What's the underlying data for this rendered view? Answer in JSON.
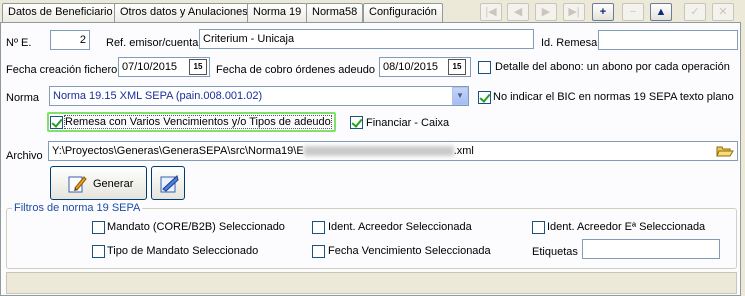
{
  "tabs": [
    {
      "label": "Datos de Beneficiario"
    },
    {
      "label": "Otros datos y Anulaciones"
    },
    {
      "label": "Norma 19"
    },
    {
      "label": "Norma58"
    },
    {
      "label": "Configuración"
    }
  ],
  "toolbar": {
    "first": "|◀",
    "prev": "◀",
    "next": "▶",
    "last": "▶|",
    "add": "+",
    "remove": "−",
    "up": "▲",
    "confirm": "✓",
    "cancel": "✕"
  },
  "form": {
    "num_label": "Nº E.",
    "num_value": "2",
    "ref_label": "Ref. emisor/cuenta",
    "ref_value": "Criterium - Unicaja",
    "id_remesa_label": "Id. Remesa",
    "id_remesa_value": "",
    "fecha_creacion_label": "Fecha creación fichero",
    "fecha_creacion_value": "07/10/2015",
    "fecha_cobro_label": "Fecha de cobro órdenes adeudo",
    "fecha_cobro_value": "08/10/2015",
    "calendar_icon": "15",
    "detalle_label": "Detalle del abono: un abono por cada operación",
    "norma_label": "Norma",
    "norma_value": "Norma 19.15 XML SEPA (pain.008.001.02)",
    "no_bic_label": "No indicar el BIC en normas 19 SEPA texto plano",
    "remesa_varios_label": "Remesa con Varios Vencimientos y/o Tipos de adeudo",
    "financiar_label": "Financiar - Caixa",
    "archivo_label": "Archivo",
    "archivo_value_prefix": "Y:\\Proyectos\\Generas\\GeneraSEPA\\src\\Norma19\\E",
    "archivo_value_suffix": ".xml",
    "generar_label": "Generar"
  },
  "filtros": {
    "title": "Filtros de norma 19 SEPA",
    "mandato_label": "Mandato (CORE/B2B) Seleccionado",
    "ident_acreedor_label": "Ident. Acreedor Seleccionada",
    "ident_acreedor_e_label": "Ident. Acreedor Eª Seleccionada",
    "tipo_mandato_label": "Tipo de Mandato Seleccionado",
    "fecha_venc_label": "Fecha Vencimiento Seleccionada",
    "etiquetas_label": "Etiquetas",
    "etiquetas_value": ""
  },
  "checks": {
    "detalle": false,
    "no_bic": true,
    "remesa_varios": true,
    "financiar": true,
    "mandato": false,
    "ident_acreedor": false,
    "ident_acreedor_e": false,
    "tipo_mandato": false,
    "fecha_venc": false
  },
  "colors": {
    "accent": "#e68b2c",
    "focus_green": "#7fe06a",
    "group_title": "#1a4ca8",
    "select_text": "#1a2f9a"
  },
  "icons": {
    "calendar": "calendar-icon",
    "folder": "folder-open-icon",
    "generar": "generate-document-icon",
    "send": "send-file-icon"
  }
}
